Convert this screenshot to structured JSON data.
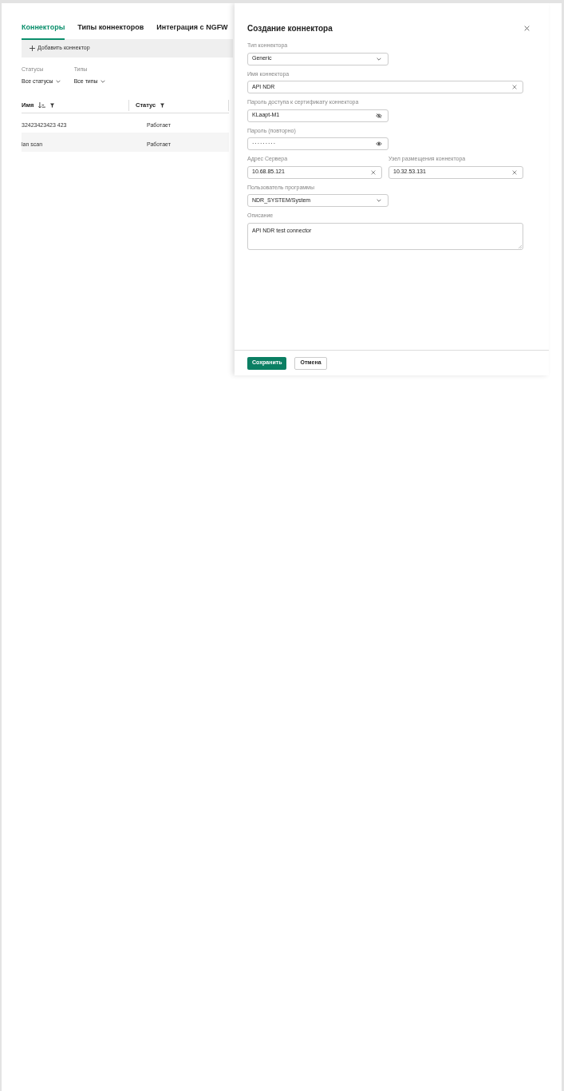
{
  "tabs": [
    {
      "label": "Коннекторы",
      "selected": true
    },
    {
      "label": "Типы коннекторов",
      "selected": false
    },
    {
      "label": "Интеграция с NGFW",
      "selected": false
    }
  ],
  "toolbar": {
    "add_button": "Добавить коннектор"
  },
  "filters": [
    {
      "label": "Статусы",
      "value": "Все статусы"
    },
    {
      "label": "Типы",
      "value": "Все типы"
    }
  ],
  "table": {
    "columns": [
      {
        "label": "Имя",
        "sortable": true
      },
      {
        "label": "Статус",
        "sortable": false
      }
    ],
    "rows": [
      [
        "32423423423 423",
        "Работает"
      ],
      [
        "lan scan",
        "Работает"
      ]
    ]
  },
  "drawer": {
    "title": "Создание коннектора",
    "rows": [
      [
        {
          "kind": "select",
          "label": "Тип коннектора",
          "value": "Generic"
        }
      ],
      [
        {
          "kind": "text",
          "label": "Имя коннектора",
          "value": "API NDR"
        }
      ],
      [
        {
          "kind": "password",
          "label": "Пароль доступа к сертификату коннектора",
          "value": "KLaapt-M1",
          "revealed": true
        }
      ],
      [
        {
          "kind": "password",
          "label": "Пароль (повторно)",
          "value": "·········",
          "revealed": false
        }
      ],
      [
        {
          "kind": "text",
          "label": "Адрес Сервера",
          "value": "10.68.85.121"
        },
        {
          "kind": "text",
          "label": "Узел размещения коннектора",
          "value": "10.32.53.131"
        }
      ],
      [
        {
          "kind": "select",
          "label": "Пользователь программы",
          "value": "NDR_SYSTEM/System"
        }
      ],
      [
        {
          "kind": "textarea",
          "label": "Описание",
          "value": "API NDR test connector"
        }
      ]
    ],
    "buttons": [
      {
        "label": "Сохранить",
        "primary": true
      },
      {
        "label": "Отмена",
        "primary": false
      }
    ]
  }
}
